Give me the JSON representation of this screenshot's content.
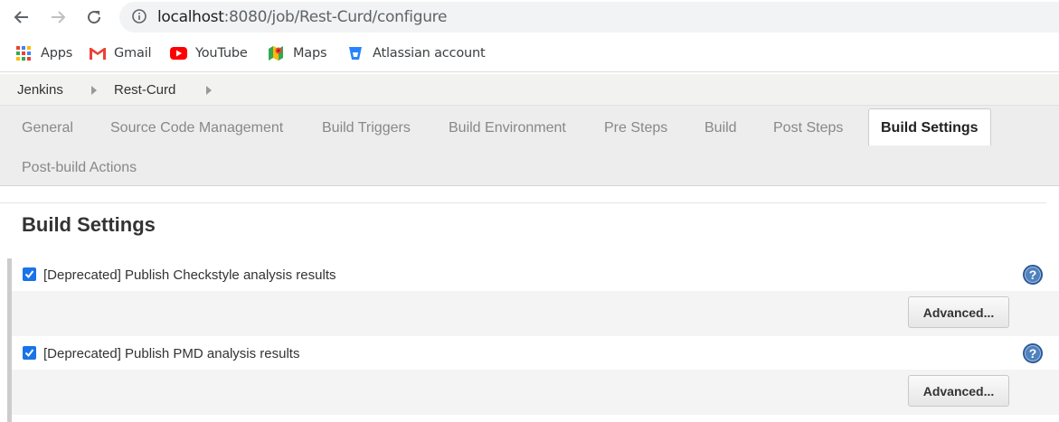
{
  "browser": {
    "url_host": "localhost",
    "url_rest": ":8080/job/Rest-Curd/configure"
  },
  "bookmarks": [
    {
      "label": "Apps",
      "icon": "apps-grid-icon"
    },
    {
      "label": "Gmail",
      "icon": "gmail-icon"
    },
    {
      "label": "YouTube",
      "icon": "youtube-icon"
    },
    {
      "label": "Maps",
      "icon": "maps-icon"
    },
    {
      "label": "Atlassian account",
      "icon": "atlassian-icon"
    }
  ],
  "breadcrumb": {
    "items": [
      "Jenkins",
      "Rest-Curd"
    ]
  },
  "tabs": [
    {
      "label": "General"
    },
    {
      "label": "Source Code Management"
    },
    {
      "label": "Build Triggers"
    },
    {
      "label": "Build Environment"
    },
    {
      "label": "Pre Steps"
    },
    {
      "label": "Build"
    },
    {
      "label": "Post Steps"
    },
    {
      "label": "Build Settings",
      "active": true
    },
    {
      "label": "Post-build Actions"
    }
  ],
  "section": {
    "title": "Build Settings",
    "items": [
      {
        "label": "[Deprecated] Publish Checkstyle analysis results",
        "checked": true,
        "button": "Advanced..."
      },
      {
        "label": "[Deprecated] Publish PMD analysis results",
        "checked": true,
        "button": "Advanced..."
      }
    ],
    "help_symbol": "?"
  },
  "colors": {
    "checkbox": "#1a73e8",
    "help": "#4f81bd",
    "breadcrumb_bg": "#f2f2f0",
    "tabbar_bg": "#ededed"
  }
}
